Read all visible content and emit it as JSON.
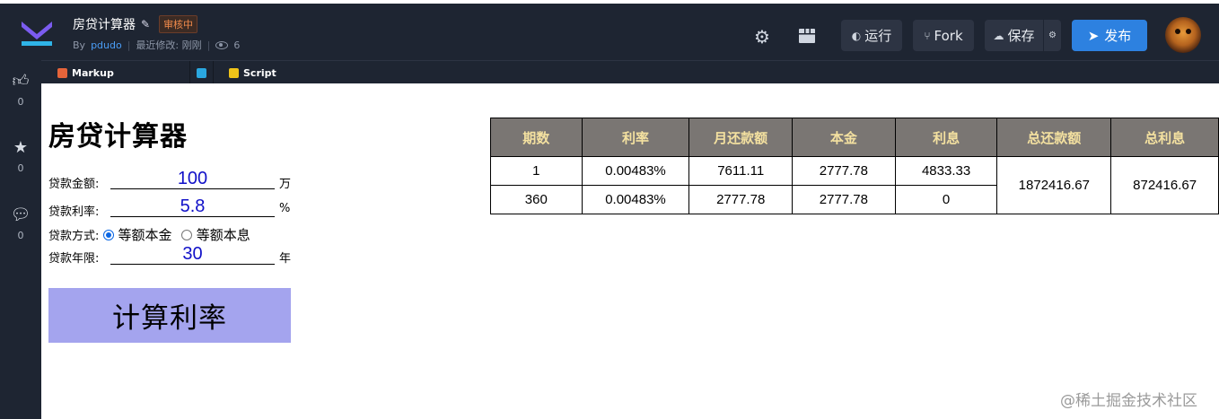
{
  "header": {
    "title": "房贷计算器",
    "status_badge": "审核中",
    "by_label": "By",
    "author": "pdudo",
    "modified_label": "最近修改: 刚刚",
    "views": "6",
    "run_label": "运行",
    "fork_label": "Fork",
    "save_label": "保存",
    "publish_label": "发布"
  },
  "sidebar": {
    "like_count": "0",
    "star_count": "0",
    "comment_count": "0"
  },
  "tabs": [
    {
      "label": "Markup"
    },
    {
      "label": "Script"
    }
  ],
  "calculator": {
    "heading": "房贷计算器",
    "amount_label": "贷款金额:",
    "amount_value": "100",
    "amount_unit": "万",
    "rate_label": "贷款利率:",
    "rate_value": "5.8",
    "rate_unit": "%",
    "method_label": "贷款方式:",
    "method_option_1": "等额本金",
    "method_option_2": "等额本息",
    "method_selected": "等额本金",
    "years_label": "贷款年限:",
    "years_value": "30",
    "years_unit": "年",
    "calc_button": "计算利率"
  },
  "results": {
    "headers": [
      "期数",
      "利率",
      "月还款额",
      "本金",
      "利息",
      "总还款额",
      "总利息"
    ],
    "rows": [
      [
        "1",
        "0.00483%",
        "7611.11",
        "2777.78",
        "4833.33"
      ],
      [
        "360",
        "0.00483%",
        "2777.78",
        "2777.78",
        "0"
      ]
    ],
    "total_payment": "1872416.67",
    "total_interest": "872416.67"
  },
  "watermark": "@稀土掘金技术社区",
  "colors": {
    "topbar_bg": "#1e2532",
    "publish_bg": "#2d81e0",
    "calc_button_bg": "#a4a4ee",
    "table_header_bg": "#7a7673",
    "table_header_text": "#f4e1a0",
    "input_text": "#1010c8"
  }
}
